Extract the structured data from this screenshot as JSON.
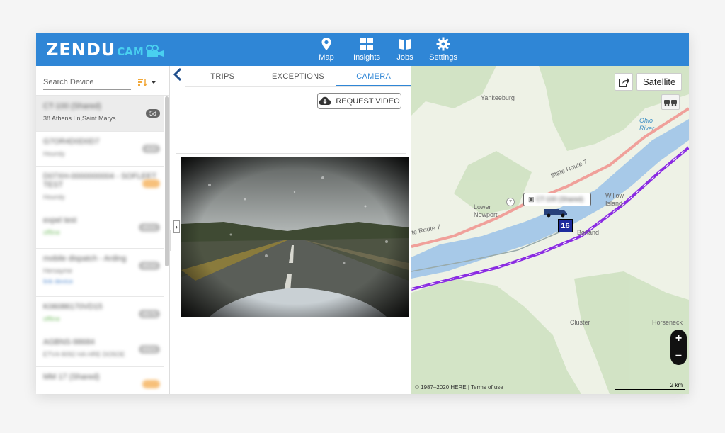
{
  "brand": {
    "logo_main": "ZENDU",
    "logo_sub": "CAM"
  },
  "nav": [
    {
      "label": "Map",
      "icon": "map-pin-icon"
    },
    {
      "label": "Insights",
      "icon": "grid-icon"
    },
    {
      "label": "Jobs",
      "icon": "book-icon"
    },
    {
      "label": "Settings",
      "icon": "gear-icon"
    }
  ],
  "search": {
    "placeholder": "Search Device"
  },
  "devices": [
    {
      "name": "CT-100 (Shared)",
      "sub": "38 Athens Ln,Saint Marys",
      "badge": "5d"
    },
    {
      "name": "G7OR4D0D0D7",
      "sub": "Hoursly",
      "badge": "420"
    },
    {
      "name": "D07XH-0000000004 - SOFLEET TEST",
      "sub": "Hoursly",
      "badge": "10d"
    },
    {
      "name": "expel test",
      "sub": "offline",
      "badge": "4531"
    },
    {
      "name": "mobile dispatch - Arding",
      "sub": "Hersayme",
      "sub2": "link device",
      "badge": "4533"
    },
    {
      "name": "K06086170VD15",
      "sub": "offline",
      "badge": "4575"
    },
    {
      "name": "AGBNS-98684",
      "sub": "ETV4-9092 HA HRE DO5OE",
      "badge": "4321"
    },
    {
      "name": "MM 17 (Shared)",
      "sub": "",
      "badge": "14d"
    }
  ],
  "tabs": [
    {
      "label": "TRIPS",
      "active": false
    },
    {
      "label": "EXCEPTIONS",
      "active": false
    },
    {
      "label": "CAMERA",
      "active": true
    }
  ],
  "request_video_label": "REQUEST VIDEO",
  "map": {
    "satellite_label": "Satellite",
    "zoom_in": "+",
    "zoom_out": "−",
    "copyright": "© 1987–2020 HERE | Terms of use",
    "scale_label": "2 km",
    "vehicle_label": "CT-100 (Shared)",
    "vehicle_marker": "16",
    "places": [
      "Yankeeburg",
      "Ohio River",
      "State Route 7",
      "Lower Newport",
      "Willow Island",
      "Borland",
      "Cluster",
      "Horseneck",
      "te Route 7",
      "7"
    ]
  },
  "colors": {
    "topbar": "#2f86d6",
    "accent": "#2f86d6",
    "route": "#8a2be2"
  }
}
